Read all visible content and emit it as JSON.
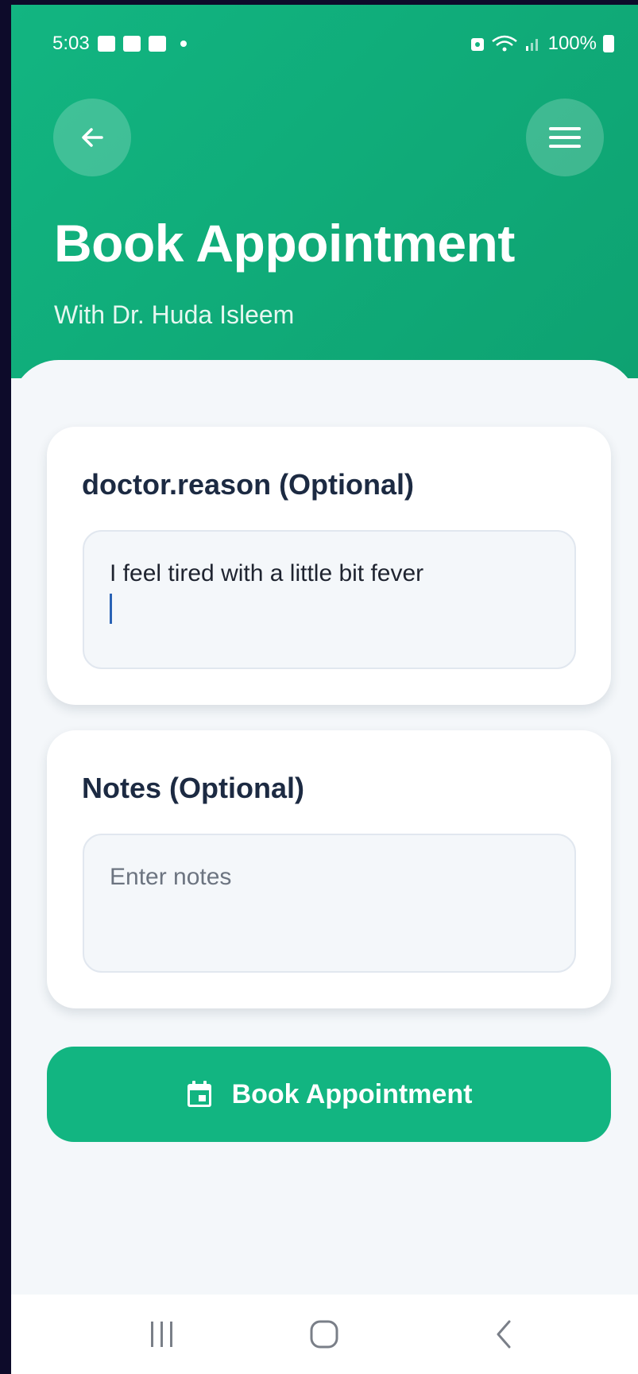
{
  "status_bar": {
    "time": "5:03",
    "battery": "100%"
  },
  "header": {
    "title": "Book Appointment",
    "subtitle": "With Dr. Huda Isleem"
  },
  "reason_card": {
    "label": "doctor.reason (Optional)",
    "value": "I feel tired with  a little bit fever"
  },
  "notes_card": {
    "label": "Notes (Optional)",
    "placeholder": "Enter notes",
    "value": ""
  },
  "book_button": {
    "label": "Book Appointment",
    "icon": "calendar-icon"
  },
  "colors": {
    "primary": "#12b581",
    "title_text": "#1c2a42",
    "background": "#f4f7fa"
  },
  "icons": {
    "back": "arrow-left-icon",
    "menu": "hamburger-menu-icon",
    "nav_recent": "recent-apps-icon",
    "nav_home": "home-icon",
    "nav_back": "chevron-left-icon"
  }
}
